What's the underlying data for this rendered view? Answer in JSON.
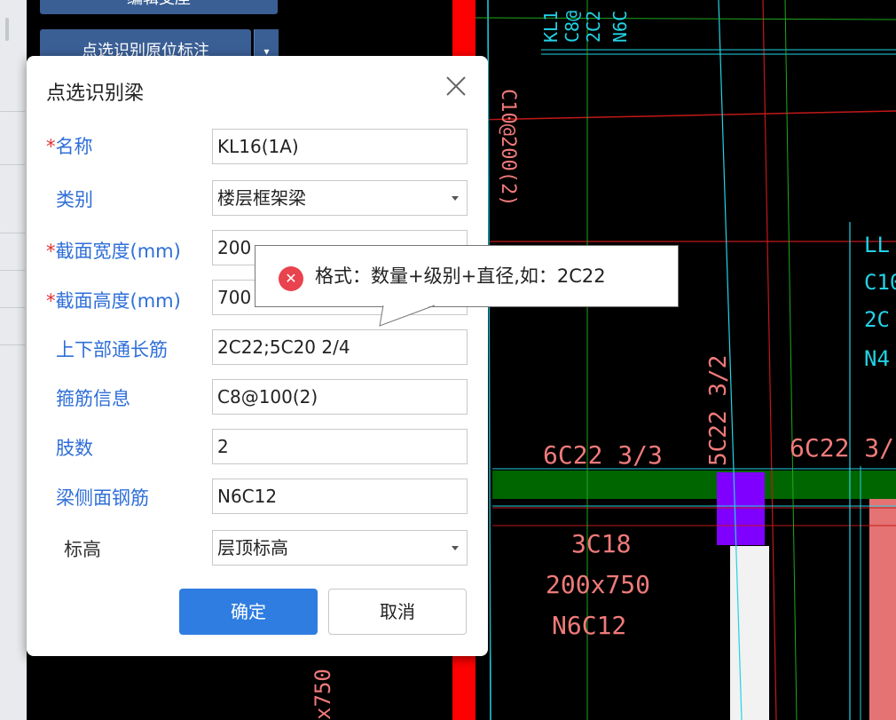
{
  "toolbar": {
    "top_button_label": "编辑支座",
    "recognize_button_label": "点选识别原位标注",
    "dropdown_glyph": "▾"
  },
  "cad": {
    "vertical_tag_top": "C10@200(2)",
    "tags_top_right": [
      "KL1",
      "C8@",
      "2C2",
      "N6C"
    ],
    "tags_right": [
      "LL",
      "C10",
      "2C",
      "N4"
    ],
    "label_5c22": "5C22 3/2",
    "label_6c22_left": "6C22 3/3",
    "label_6c22_right": "6C22 3/",
    "label_3c18": "3C18",
    "label_size": "200x750",
    "label_n6c12": "N6C12",
    "label_bottom_vertical": "x750",
    "colors": {
      "beam_red": "#ff0000",
      "beam_green": "#006600",
      "column_purple": "#8000ff",
      "axis_cyan": "#22d3e6",
      "label_pink": "#f07a7a"
    }
  },
  "dialog": {
    "title": "点选识别梁",
    "required_mark": "*",
    "fields": {
      "name": {
        "label": "名称",
        "value": "KL16(1A)"
      },
      "category": {
        "label": "类别",
        "value": "楼层框架梁"
      },
      "section_width": {
        "label": "截面宽度(mm)",
        "value": "200"
      },
      "section_height": {
        "label": "截面高度(mm)",
        "value": "700"
      },
      "through_rebar": {
        "label": "上下部通长筋",
        "value": "2C22;5C20 2/4"
      },
      "stirrup": {
        "label": "箍筋信息",
        "value": "C8@100(2)"
      },
      "legs": {
        "label": "肢数",
        "value": "2"
      },
      "side_rebar": {
        "label": "梁侧面钢筋",
        "value": "N6C12"
      },
      "elevation": {
        "label": "标高",
        "value": "层顶标高"
      }
    },
    "ok_label": "确定",
    "cancel_label": "取消"
  },
  "tooltip": {
    "icon_glyph": "✕",
    "message": "格式：数量+级别+直径,如：2C22"
  }
}
